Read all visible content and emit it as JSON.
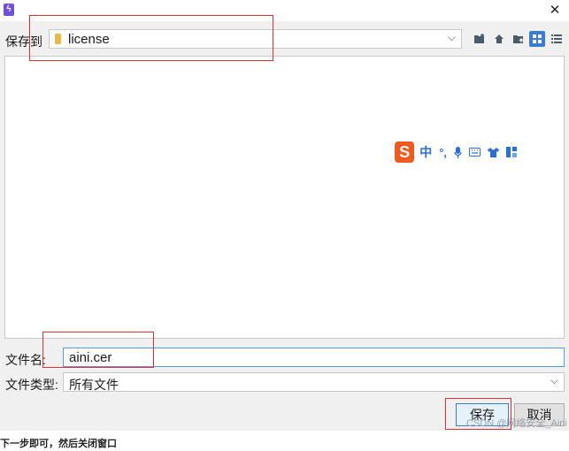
{
  "window": {
    "close_glyph": "✕"
  },
  "save_location": {
    "label": "保存到",
    "folder": "license"
  },
  "toolbar": {
    "icons": [
      "new-folder-icon",
      "home-icon",
      "folder-up-icon",
      "grid-view-icon",
      "list-view-icon"
    ],
    "active_color": "#3a7bd5"
  },
  "ime_bar": {
    "logo": "S",
    "mode": "中",
    "punct": "°,"
  },
  "filename": {
    "label": "文件名:",
    "value": "aini.cer"
  },
  "filetype": {
    "label": "文件类型:",
    "value": "所有文件"
  },
  "buttons": {
    "save": "保存",
    "cancel": "取消"
  },
  "watermark": "CSDN @网络安全_Aini",
  "caption": "下一步即可，然后关闭窗口",
  "annotation_color": "#e0303a"
}
